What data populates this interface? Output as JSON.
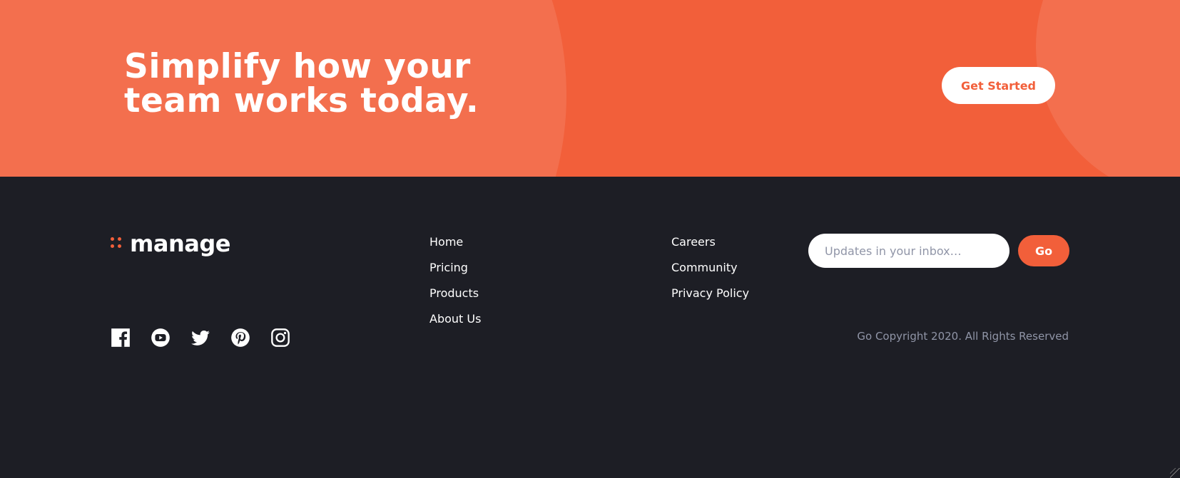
{
  "colors": {
    "accent": "#f25f3a",
    "footer_background": "#1d1e25",
    "text_light": "#ffffff",
    "text_muted": "#9095a7"
  },
  "cta": {
    "title": "Simplify how your team works today.",
    "button_label": "Get Started"
  },
  "footer": {
    "logo_text": "manage",
    "social_icons": [
      "facebook-icon",
      "youtube-icon",
      "twitter-icon",
      "pinterest-icon",
      "instagram-icon"
    ],
    "links_column_1": [
      "Home",
      "Pricing",
      "Products",
      "About Us"
    ],
    "links_column_2": [
      "Careers",
      "Community",
      "Privacy Policy"
    ],
    "newsletter": {
      "placeholder": "Updates in your inbox…",
      "button_label": "Go"
    },
    "copyright": "Go Copyright 2020. All Rights Reserved"
  }
}
